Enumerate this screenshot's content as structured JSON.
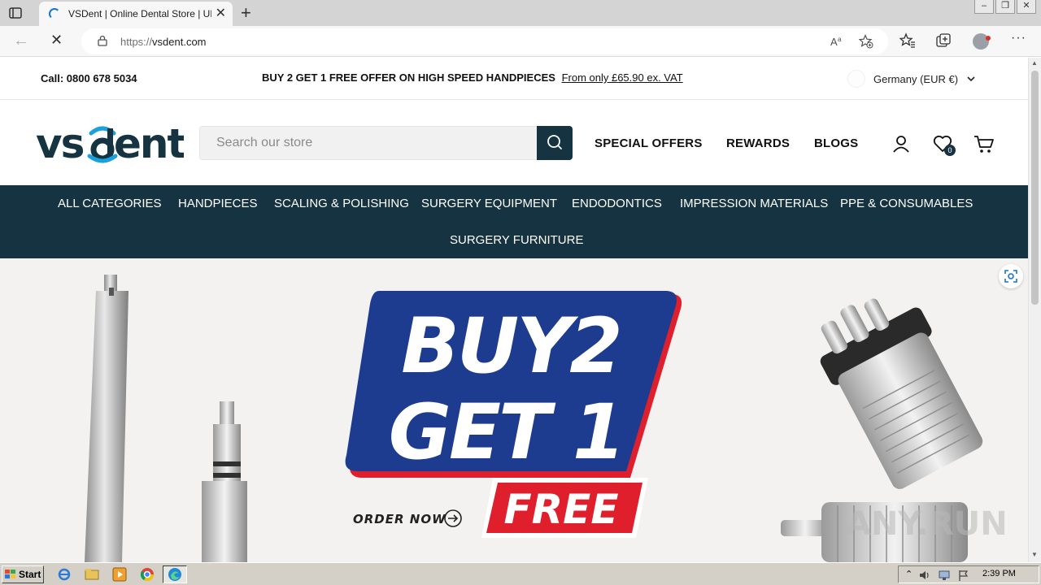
{
  "browser": {
    "tab_title": "VSDent | Online Dental Store | UK",
    "url_protocol": "https://",
    "url_host": "vsdent.com",
    "new_tab_symbol": "+",
    "close_symbol": "✕",
    "more_symbol": "···"
  },
  "topbar": {
    "call": "Call: 0800 678 5034",
    "promo_bold": "BUY 2 GET 1 FREE OFFER ON HIGH SPEED HANDPIECES",
    "promo_link": "From only £65.90 ex. VAT",
    "currency": "Germany (EUR €)"
  },
  "header": {
    "logo_text": "vsdent",
    "search_placeholder": "Search our store",
    "nav": [
      "SPECIAL OFFERS",
      "REWARDS",
      "BLOGS"
    ],
    "wishlist_count": "0"
  },
  "categories": [
    "ALL CATEGORIES",
    "HANDPIECES",
    "SCALING & POLISHING",
    "SURGERY EQUIPMENT",
    "ENDODONTICS",
    "IMPRESSION MATERIALS",
    "PPE & CONSUMABLES",
    "SURGERY FURNITURE"
  ],
  "hero": {
    "line1": "BUY2",
    "line2": "GET 1",
    "free": "FREE",
    "cta": "ORDER NOW"
  },
  "watermark": "ANY.RUN",
  "taskbar": {
    "start": "Start",
    "clock": "2:39 PM"
  },
  "colors": {
    "brand_dark": "#153340",
    "brand_accent": "#1aa0dc",
    "hero_navy": "#1d3c8f",
    "hero_red": "#e01f2d"
  }
}
